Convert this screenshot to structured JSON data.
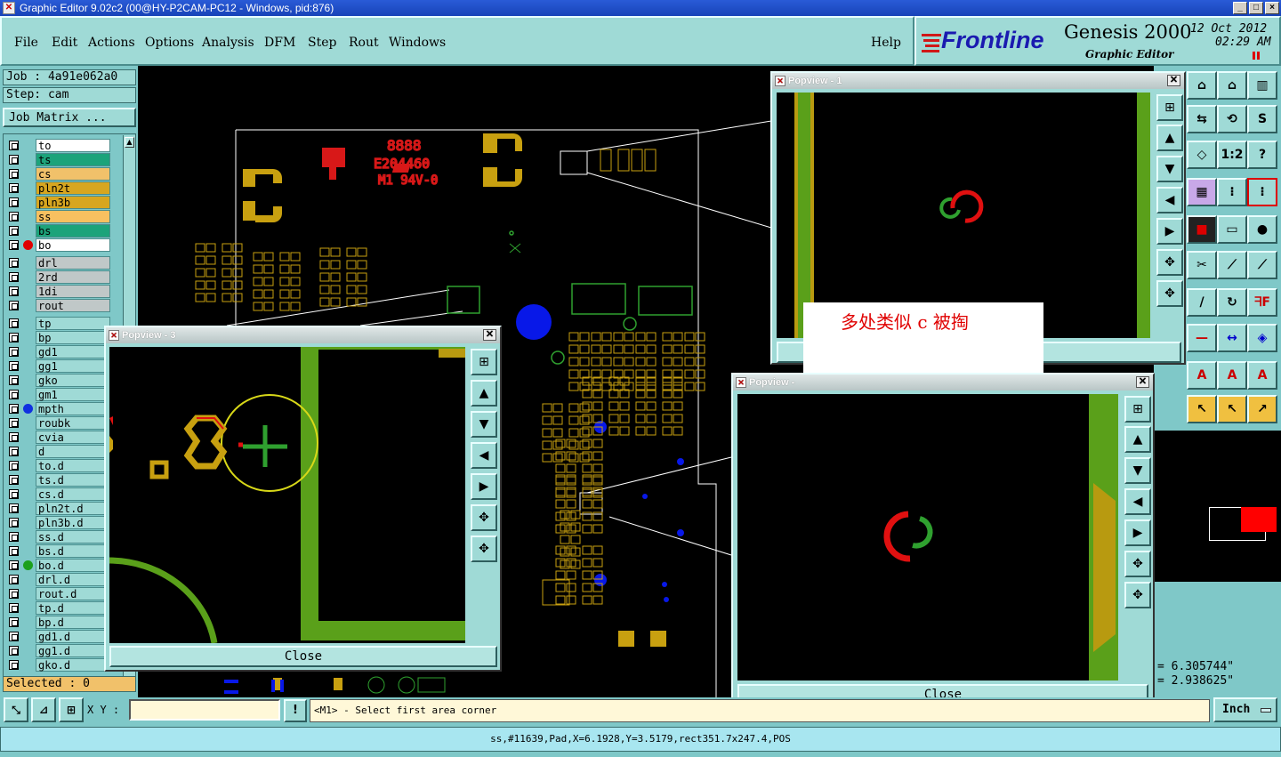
{
  "window": {
    "title": "Graphic Editor 9.02c2 (00@HY-P2CAM-PC12 - Windows, pid:876)"
  },
  "menu": {
    "items": [
      "File",
      "Edit",
      "Actions",
      "Options",
      "Analysis",
      "DFM",
      "Step",
      "Rout",
      "Windows"
    ],
    "help": "Help"
  },
  "brand": {
    "company": "Frontline",
    "product": "Genesis 2000",
    "module": "Graphic Editor",
    "date": "12 Oct 2012",
    "time": "02:29 AM"
  },
  "job": {
    "job_line": "Job : 4a91e062a0",
    "step_line": "Step: cam",
    "matrix_button": "Job Matrix ..."
  },
  "layers": [
    {
      "name": "to",
      "color": "#ffffff"
    },
    {
      "name": "ts",
      "color": "#1ca37a"
    },
    {
      "name": "cs",
      "color": "#f1c16a"
    },
    {
      "name": "pln2t",
      "color": "#d7a620"
    },
    {
      "name": "pln3b",
      "color": "#d7a620"
    },
    {
      "name": "ss",
      "color": "#f8c060"
    },
    {
      "name": "bs",
      "color": "#1ca37a"
    },
    {
      "name": "bo",
      "color": "#ffffff",
      "dot": "#e00000"
    },
    {
      "name": "drl",
      "color": "#c0c8c8"
    },
    {
      "name": "2rd",
      "color": "#c0c8c8"
    },
    {
      "name": "1di",
      "color": "#c0c8c8"
    },
    {
      "name": "rout",
      "color": "#c0c8c8"
    },
    {
      "name": "tp",
      "color": "#9fdad6"
    },
    {
      "name": "bp",
      "color": "#9fdad6"
    },
    {
      "name": "gd1",
      "color": "#9fdad6"
    },
    {
      "name": "gg1",
      "color": "#9fdad6"
    },
    {
      "name": "gko",
      "color": "#9fdad6"
    },
    {
      "name": "gm1",
      "color": "#9fdad6"
    },
    {
      "name": "mpth",
      "color": "#9fdad6",
      "dot": "#1030e0"
    },
    {
      "name": "roubk",
      "color": "#9fdad6"
    },
    {
      "name": "cvia",
      "color": "#9fdad6"
    },
    {
      "name": "d",
      "color": "#9fdad6"
    },
    {
      "name": "to.d",
      "color": "#9fdad6"
    },
    {
      "name": "ts.d",
      "color": "#9fdad6"
    },
    {
      "name": "cs.d",
      "color": "#9fdad6"
    },
    {
      "name": "pln2t.d",
      "color": "#9fdad6"
    },
    {
      "name": "pln3b.d",
      "color": "#9fdad6"
    },
    {
      "name": "ss.d",
      "color": "#9fdad6"
    },
    {
      "name": "bs.d",
      "color": "#9fdad6"
    },
    {
      "name": "bo.d",
      "color": "#9fdad6",
      "dot": "#1ca01c"
    },
    {
      "name": "drl.d",
      "color": "#9fdad6"
    },
    {
      "name": "rout.d",
      "color": "#9fdad6"
    },
    {
      "name": "tp.d",
      "color": "#9fdad6"
    },
    {
      "name": "bp.d",
      "color": "#9fdad6"
    },
    {
      "name": "gd1.d",
      "color": "#9fdad6"
    },
    {
      "name": "gg1.d",
      "color": "#9fdad6"
    },
    {
      "name": "gko.d",
      "color": "#9fdad6"
    }
  ],
  "selected": "Selected : 0",
  "popups": {
    "p1": {
      "title": "Popview - 1"
    },
    "p2": {
      "title": "Popview -",
      "close": "Close"
    },
    "p3": {
      "title": "Popview - 3",
      "close": "Close"
    }
  },
  "note": "多处类似 c 被掏",
  "coords": {
    "x": "= 6.305744\"",
    "y": "= 2.938625\""
  },
  "command": {
    "xy_label": "X Y :",
    "xy_value": "",
    "prompt": "<M1> - Select first area corner",
    "unit": "Inch"
  },
  "status": "ss,#11639,Pad,X=6.1928,Y=3.5179,rect351.7x247.4,POS",
  "icons": [
    "window-close-icon",
    "zoom-icon",
    "ruler-icon",
    "snap-icon",
    "pan-icon",
    "home-icon"
  ]
}
